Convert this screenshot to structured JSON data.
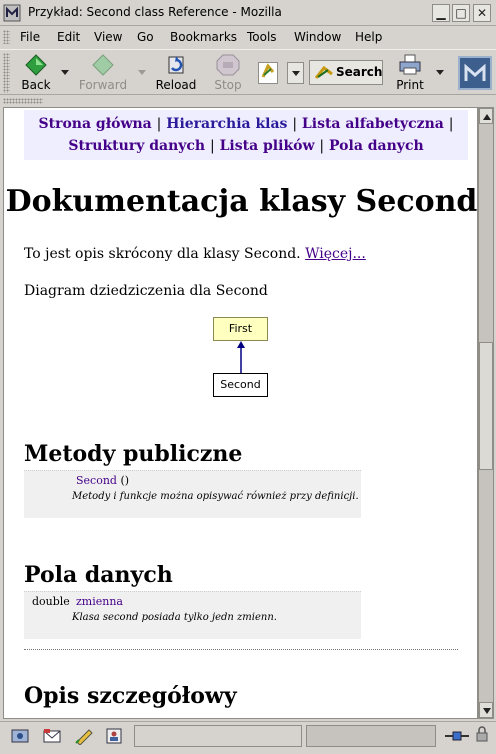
{
  "window": {
    "title": "Przykład: Second class Reference - Mozilla"
  },
  "menu": [
    "File",
    "Edit",
    "View",
    "Go",
    "Bookmarks",
    "Tools",
    "Window",
    "Help"
  ],
  "toolbar": {
    "back": "Back",
    "forward": "Forward",
    "reload": "Reload",
    "stop": "Stop",
    "search": "Search",
    "print": "Print"
  },
  "page": {
    "nav": [
      "Strona główna",
      "Hierarchia klas",
      "Lista alfabetyczna",
      "Struktury danych",
      "Lista plików",
      "Pola danych"
    ],
    "nav_separator": "|",
    "heading": "Dokumentacja klasy Second",
    "intro_text": "To jest opis skrócony dla klasy Second.",
    "more_link": "Więcej...",
    "diagram_caption": "Diagram dziedziczenia dla Second",
    "diagram_parent": "First",
    "diagram_child": "Second",
    "public_methods_heading": "Metody publiczne",
    "method_name": "Second",
    "method_args": "()",
    "method_desc": "Metody i funkcje można opisywać również przy definicji.",
    "data_fields_heading": "Pola danych",
    "field_type": "double",
    "field_name": "zmienna",
    "field_desc": "Klasa second posiada tylko jedn zmienn.",
    "detail_heading": "Opis szczegółowy"
  },
  "colors": {
    "chrome": "#d6d3ce",
    "nav_bg": "#eeeeff",
    "link": "#440088",
    "diagram_parent_fill": "#ffffc0"
  }
}
